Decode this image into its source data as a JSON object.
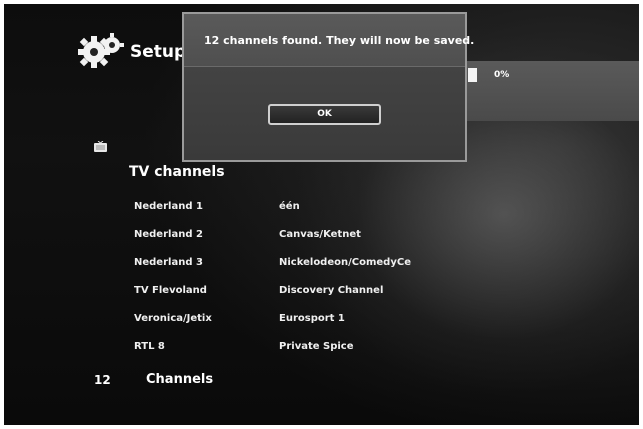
{
  "header": {
    "title": "Setup",
    "logo_icon": "gears-icon"
  },
  "progress": {
    "label": "0%",
    "value_percent": 0
  },
  "tv_section": {
    "icon": "tv-icon",
    "title": "TV channels",
    "channels": [
      [
        "Nederland 1",
        "één"
      ],
      [
        "Nederland 2",
        "Canvas/Ketnet"
      ],
      [
        "Nederland 3",
        "Nickelodeon/ComedyCe"
      ],
      [
        "TV Flevoland",
        "Discovery Channel"
      ],
      [
        "Veronica/Jetix",
        "Eurosport 1"
      ],
      [
        "RTL 8",
        "Private Spice"
      ]
    ],
    "count_number": "12",
    "count_label": "Channels"
  },
  "dialog": {
    "message": "12 channels found. They will now be saved.",
    "ok_label": "OK"
  },
  "colors": {
    "background": "#0d0d0d",
    "dialog_background": "#444444",
    "dialog_border": "#9a9a9a",
    "text": "#ffffff"
  }
}
